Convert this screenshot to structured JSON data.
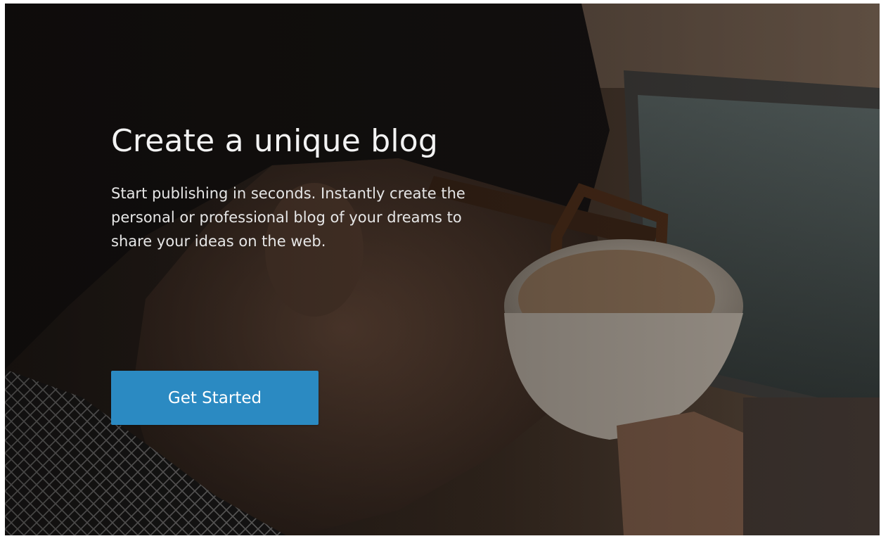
{
  "hero": {
    "title": "Create a unique blog",
    "description": "Start publishing in seconds. Instantly create the personal or professional blog of your dreams to share your ideas on the web.",
    "cta_label": "Get Started",
    "accent_color": "#2b8ac2"
  }
}
